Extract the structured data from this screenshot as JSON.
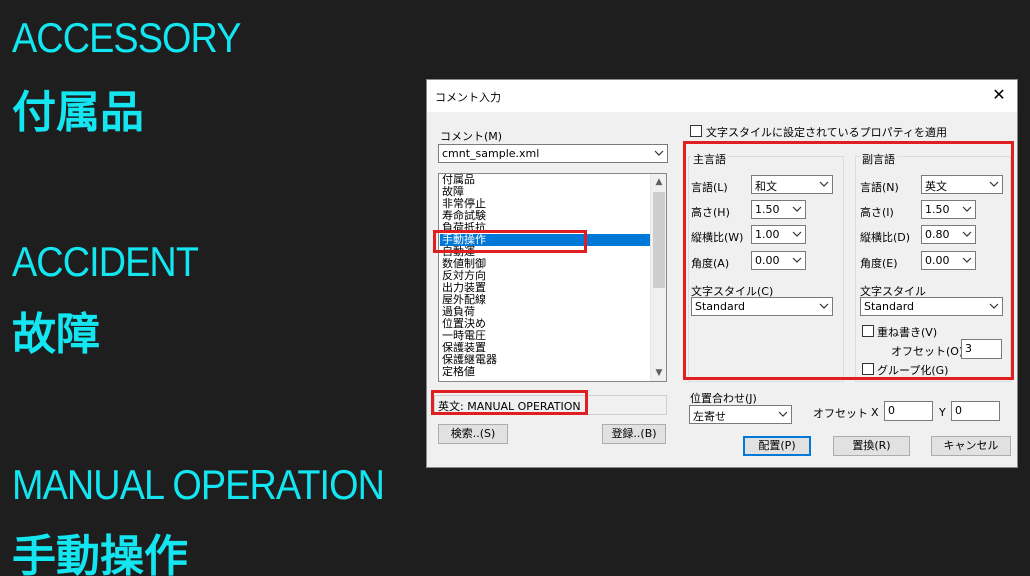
{
  "captions": [
    {
      "en": "ACCESSORY",
      "jp": "付属品"
    },
    {
      "en": "ACCIDENT",
      "jp": "故障"
    },
    {
      "en": "MANUAL OPERATION",
      "jp": "手動操作"
    }
  ],
  "dialog": {
    "title": "コメント入力",
    "close": "✕",
    "comment_label": "コメント(M)",
    "comment_file": "cmnt_sample.xml",
    "list_items": [
      "付属品",
      "故障",
      "非常停止",
      "寿命試験",
      "負荷抵抗",
      "手動操作",
      "自動運",
      "数値制御",
      "反対方向",
      "出力装置",
      "屋外配線",
      "過負荷",
      "位置決め",
      "一時電圧",
      "保護装置",
      "保護継電器",
      "定格値"
    ],
    "selected_item": "手動操作",
    "english_label": "英文: MANUAL OPERATION",
    "search_button": "検索..(S)",
    "register_button": "登録..(B)",
    "apply_style_checkbox": "文字スタイルに設定されているプロパティを適用",
    "primary": {
      "header": "主言語",
      "language_label": "言語(L)",
      "language_value": "和文",
      "height_label": "高さ(H)",
      "height_value": "1.50",
      "ratio_label": "縦横比(W)",
      "ratio_value": "1.00",
      "angle_label": "角度(A)",
      "angle_value": "0.00",
      "style_label": "文字スタイル(C)",
      "style_value": "Standard"
    },
    "secondary": {
      "header": "副言語",
      "language_label": "言語(N)",
      "language_value": "英文",
      "height_label": "高さ(I)",
      "height_value": "1.50",
      "ratio_label": "縦横比(D)",
      "ratio_value": "0.80",
      "angle_label": "角度(E)",
      "angle_value": "0.00",
      "style_label": "文字スタイル",
      "style_value": "Standard",
      "overlap_checkbox": "重ね書き(V)",
      "offset_label": "オフセット(O)",
      "offset_value": "3",
      "group_checkbox": "グループ化(G)"
    },
    "align_label": "位置合わせ(J)",
    "align_value": "左寄せ",
    "offset_label": "オフセット",
    "x_label": "X",
    "x_value": "0",
    "y_label": "Y",
    "y_value": "0",
    "place_button": "配置(P)",
    "replace_button": "置換(R)",
    "cancel_button": "キャンセル"
  },
  "colors": {
    "caption": "#13e6f0",
    "highlight": "#e02020",
    "selection": "#0078d7"
  }
}
